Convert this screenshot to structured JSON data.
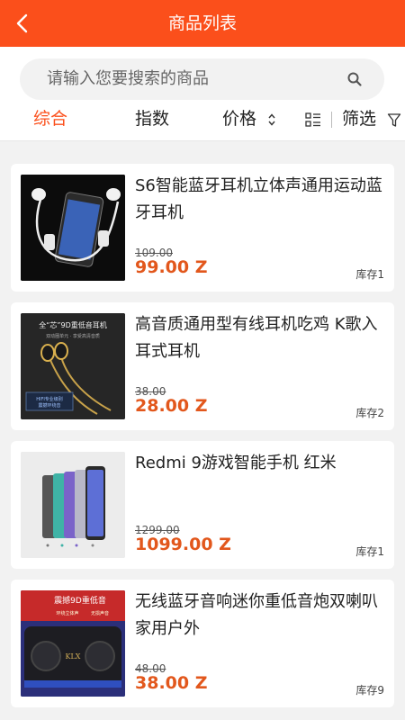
{
  "header": {
    "title": "商品列表"
  },
  "search": {
    "placeholder": "请输入您要搜索的商品"
  },
  "tabs": {
    "overall": "综合",
    "index": "指数",
    "price": "价格",
    "filter": "筛选"
  },
  "colors": {
    "accent": "#fb4f1b",
    "price": "#e2571c"
  },
  "products": [
    {
      "name": "S6智能蓝牙耳机立体声通用运动蓝牙耳机",
      "original_price": "109.00",
      "price": "99.00 Z",
      "stock": "库存1"
    },
    {
      "name": "高音质通用型有线耳机吃鸡 K歌入耳式耳机",
      "original_price": "38.00",
      "price": "28.00 Z",
      "stock": "库存2"
    },
    {
      "name": "Redmi 9游戏智能手机 红米",
      "original_price": "1299.00",
      "price": "1099.00 Z",
      "stock": "库存1"
    },
    {
      "name": "无线蓝牙音响迷你重低音炮双喇叭家用户外",
      "original_price": "48.00",
      "price": "38.00 Z",
      "stock": "库存9"
    }
  ],
  "thumb_text": {
    "p2_banner": "全“芯”9D重低音耳机",
    "p2_sub": "双动圈单元 · 享受高清音质",
    "p2_box1": "HIFI专业级别",
    "p2_box2": "震撼环绕音",
    "p4_banner": "震撼9D重低音",
    "p4_tag1": "环绕立体声",
    "p4_tag2": "无损声音",
    "p4_logo": "KLX"
  },
  "icons": {
    "back": "chevron-left-icon",
    "search": "search-icon",
    "sort": "sort-updown-icon",
    "layout": "list-layout-icon",
    "filter": "filter-funnel-icon"
  }
}
